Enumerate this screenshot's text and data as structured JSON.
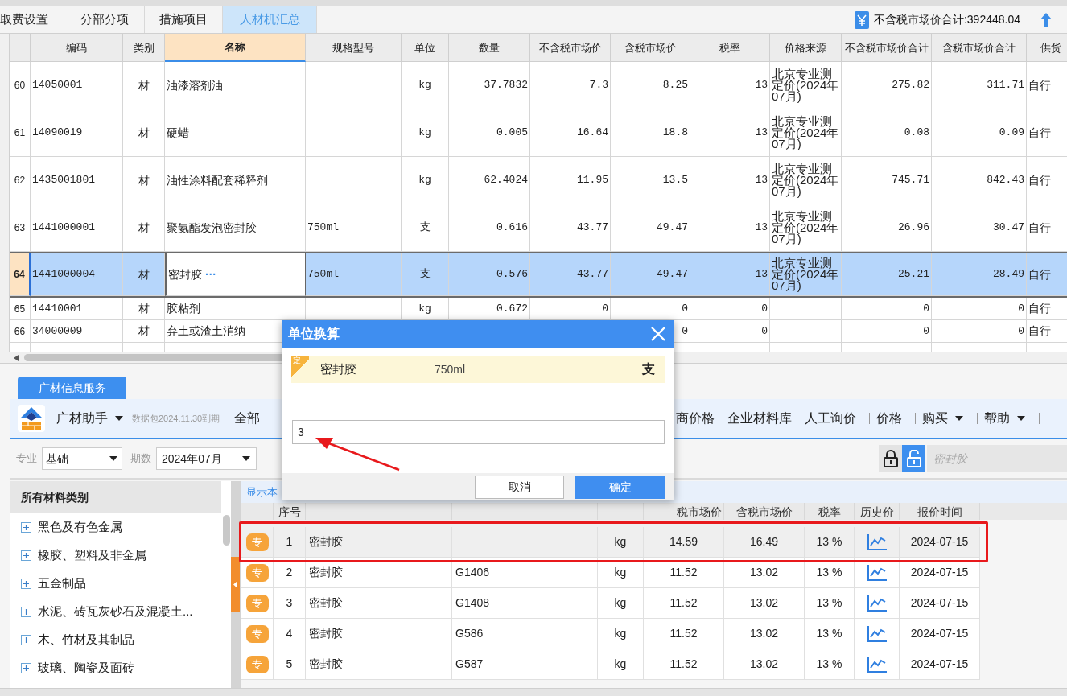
{
  "top_tabs": [
    {
      "label": "取费设置",
      "selected": false
    },
    {
      "label": "分部分项",
      "selected": false
    },
    {
      "label": "措施项目",
      "selected": false
    },
    {
      "label": "人材机汇总",
      "selected": true
    }
  ],
  "summary": {
    "label": "不含税市场价合计:392448.04"
  },
  "material_table": {
    "columns": [
      {
        "selected": false
      },
      {
        "label": "编码",
        "selected": false
      },
      {
        "label": "类别",
        "selected": false
      },
      {
        "label": "名称",
        "selected": true
      },
      {
        "label": "规格型号",
        "selected": false
      },
      {
        "label": "单位",
        "selected": false
      },
      {
        "label": "数量",
        "selected": false
      },
      {
        "label": "不含税市场价",
        "selected": false
      },
      {
        "label": "含税市场价",
        "selected": false
      },
      {
        "label": "税率",
        "selected": false
      },
      {
        "label": "价格来源",
        "selected": false
      },
      {
        "label": "不含税市场价合计",
        "selected": false
      },
      {
        "label": "含税市场价合计",
        "selected": false
      },
      {
        "label": "供货",
        "selected": false
      }
    ],
    "rows": [
      {
        "row_number": "60",
        "code": "14050001",
        "category": "材",
        "name": "油漆溶剂油",
        "unit": "kg",
        "quantity": "37.7832",
        "price_ex_tax": "7.3",
        "price_inc_tax": "8.25",
        "tax_rate": "13",
        "price_source": "北京专业测定价(2024年07月)",
        "total_ex_tax": "275.82",
        "total_inc_tax": "311.71",
        "supplier": "自行",
        "selected": false
      },
      {
        "row_number": "61",
        "code": "14090019",
        "category": "材",
        "name": "硬蜡",
        "unit": "kg",
        "quantity": "0.005",
        "price_ex_tax": "16.64",
        "price_inc_tax": "18.8",
        "tax_rate": "13",
        "price_source": "北京专业测定价(2024年07月)",
        "total_ex_tax": "0.08",
        "total_inc_tax": "0.09",
        "supplier": "自行",
        "selected": false
      },
      {
        "row_number": "62",
        "code": "1435001801",
        "category": "材",
        "name": "油性涂料配套稀释剂",
        "unit": "kg",
        "quantity": "62.4024",
        "price_ex_tax": "11.95",
        "price_inc_tax": "13.5",
        "tax_rate": "13",
        "price_source": "北京专业测定价(2024年07月)",
        "total_ex_tax": "745.71",
        "total_inc_tax": "842.43",
        "supplier": "自行",
        "selected": false
      },
      {
        "row_number": "63",
        "code": "1441000001",
        "category": "材",
        "name": "聚氨酯发泡密封胶",
        "spec": "750ml",
        "unit": "支",
        "quantity": "0.616",
        "price_ex_tax": "43.77",
        "price_inc_tax": "49.47",
        "tax_rate": "13",
        "price_source": "北京专业测定价(2024年07月)",
        "total_ex_tax": "26.96",
        "total_inc_tax": "30.47",
        "supplier": "自行",
        "selected": false
      },
      {
        "row_number": "64",
        "code": "1441000004",
        "category": "材",
        "name": "密封胶",
        "name_action": "···",
        "spec": "750ml",
        "unit": "支",
        "quantity": "0.576",
        "price_ex_tax": "43.77",
        "price_inc_tax": "49.47",
        "tax_rate": "13",
        "price_source": "北京专业测定价(2024年07月)",
        "total_ex_tax": "25.21",
        "total_inc_tax": "28.49",
        "supplier": "自行",
        "selected": true
      },
      {
        "row_number": "65",
        "code": "14410001",
        "category": "材",
        "name": "胶粘剂",
        "unit": "kg",
        "quantity": "0.672",
        "price_ex_tax": "0",
        "price_inc_tax": "0",
        "tax_rate": "0",
        "total_ex_tax": "0",
        "total_inc_tax": "0",
        "supplier": "自行",
        "selected": false
      },
      {
        "row_number": "66",
        "code": "34000009",
        "category": "材",
        "name": "弃土或渣土消纳",
        "price_inc_tax": "0",
        "tax_rate": "0",
        "total_ex_tax": "0",
        "total_inc_tax": "0",
        "supplier": "自行",
        "selected": false
      }
    ]
  },
  "info_panel": {
    "tab": "广材信息服务",
    "assistant": "广材助手",
    "data_package": "数据包2024.11.30到期",
    "menu": [
      {
        "label": "全部",
        "dropdown": false
      },
      {
        "label": "商价格",
        "dropdown": false
      },
      {
        "label": "企业材料库",
        "dropdown": false
      },
      {
        "label": "人工询价",
        "dropdown": false
      },
      {
        "label": "价格",
        "dropdown": false
      },
      {
        "label": "购买",
        "dropdown": true
      },
      {
        "label": "帮助",
        "dropdown": true
      }
    ],
    "specialty": {
      "label": "专业",
      "value": "基础"
    },
    "period": {
      "label": "期数",
      "value": "2024年07月"
    },
    "locks": [
      {
        "kind": "locked",
        "selected": false
      },
      {
        "kind": "unlocked",
        "selected": true
      }
    ],
    "search": {
      "placeholder": "密封胶"
    },
    "categories": {
      "title": "所有材料类别",
      "items": [
        "黑色及有色金属",
        "橡胶、塑料及非金属",
        "五金制品",
        "水泥、砖瓦灰砂石及混凝土...",
        "木、竹材及其制品",
        "玻璃、陶瓷及面砖"
      ]
    },
    "results": {
      "filter_link": "显示本",
      "column_headers": [
        "序号",
        "税市场价",
        "含税市场价",
        "税率",
        "历史价",
        "报价时间"
      ],
      "rows": [
        {
          "badge": "专",
          "index": "1",
          "name": "密封胶",
          "unit": "kg",
          "price_ex_tax": "14.59",
          "price_inc_tax": "16.49",
          "tax_rate": "13 %",
          "date": "2024-07-15",
          "selected": true
        },
        {
          "badge": "专",
          "index": "2",
          "name": "密封胶",
          "spec": "G1406",
          "unit": "kg",
          "price_ex_tax": "11.52",
          "price_inc_tax": "13.02",
          "tax_rate": "13 %",
          "date": "2024-07-15",
          "selected": false
        },
        {
          "badge": "专",
          "index": "3",
          "name": "密封胶",
          "spec": "G1408",
          "unit": "kg",
          "price_ex_tax": "11.52",
          "price_inc_tax": "13.02",
          "tax_rate": "13 %",
          "date": "2024-07-15",
          "selected": false
        },
        {
          "badge": "专",
          "index": "4",
          "name": "密封胶",
          "spec": "G586",
          "unit": "kg",
          "price_ex_tax": "11.52",
          "price_inc_tax": "13.02",
          "tax_rate": "13 %",
          "date": "2024-07-15",
          "selected": false
        },
        {
          "badge": "专",
          "index": "5",
          "name": "密封胶",
          "spec": "G587",
          "unit": "kg",
          "price_ex_tax": "11.52",
          "price_inc_tax": "13.02",
          "tax_rate": "13 %",
          "date": "2024-07-15",
          "selected": false
        }
      ]
    }
  },
  "dialog": {
    "title": "单位换算",
    "item": {
      "badge": "定",
      "name": "密封胶",
      "spec": "750ml",
      "unit": "支"
    },
    "input_value": "3",
    "buttons": [
      {
        "label": "取消",
        "kind": "secondary"
      },
      {
        "label": "确定",
        "kind": "primary"
      }
    ]
  }
}
